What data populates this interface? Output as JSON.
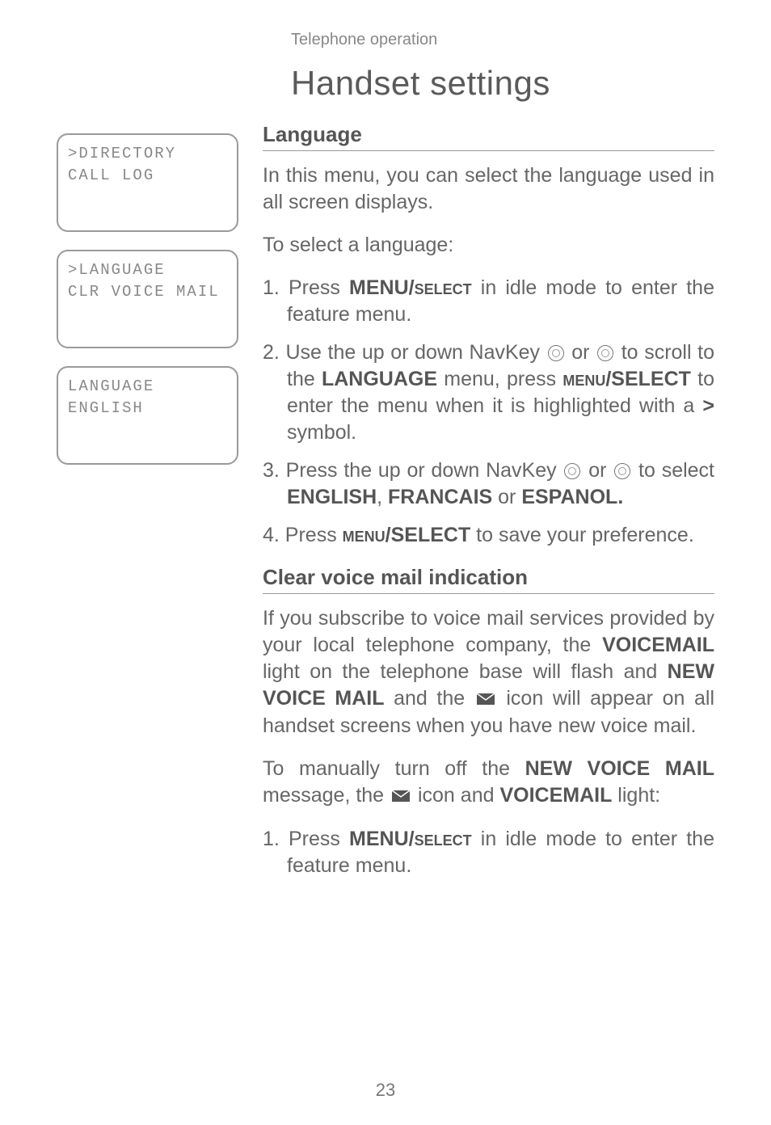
{
  "header_small": "Telephone operation",
  "main_heading": "Handset settings",
  "screens": [
    {
      "line1": ">DIRECTORY",
      "line2": " CALL LOG"
    },
    {
      "line1": ">LANGUAGE",
      "line2": " CLR VOICE MAIL"
    },
    {
      "line1": " LANGUAGE",
      "line2": " ENGLISH"
    }
  ],
  "section1": {
    "heading": "Language",
    "intro": "In this menu, you can select the language used in all screen displays.",
    "lead": "To select a language:",
    "steps": {
      "s1a": "1. Press ",
      "s1b": "MENU/",
      "s1c": "select",
      "s1d": " in idle mode to enter the feature menu.",
      "s2a": "2. Use the up or down NavKey ",
      "s2b": " or ",
      "s2c": " to scroll to the ",
      "s2d": "LANGUAGE",
      "s2e": " menu, press ",
      "s2f": "menu",
      "s2g": "/SELECT",
      "s2h": " to enter the menu when it is highlighted with a ",
      "s2i": ">",
      "s2j": " symbol.",
      "s3a": "3. Press the up or down NavKey ",
      "s3b": " or ",
      "s3c": " to select ",
      "s3d": "ENGLISH",
      "s3e": ", ",
      "s3f": "FRANCAIS",
      "s3g": " or ",
      "s3h": "ESPANOL.",
      "s4a": "4. Press ",
      "s4b": "menu",
      "s4c": "/SELECT",
      "s4d": " to save your preference."
    }
  },
  "section2": {
    "heading": "Clear voice mail indication",
    "p1a": "If you subscribe to voice mail services provided by your local telephone company, the ",
    "p1b": "VOICEMAIL",
    "p1c": " light on the telephone base will flash and ",
    "p1d": "NEW VOICE MAIL",
    "p1e": " and the ",
    "p1f": " icon will appear on all handset screens when you have new voice mail.",
    "p2a": "To manually turn off the ",
    "p2b": "NEW VOICE MAIL",
    "p2c": " message, the ",
    "p2d": " icon and ",
    "p2e": "VOICEMAIL",
    "p2f": " light:",
    "s1a": "1. Press ",
    "s1b": "MENU/",
    "s1c": "select",
    "s1d": " in idle mode to enter the feature menu."
  },
  "page_number": "23"
}
